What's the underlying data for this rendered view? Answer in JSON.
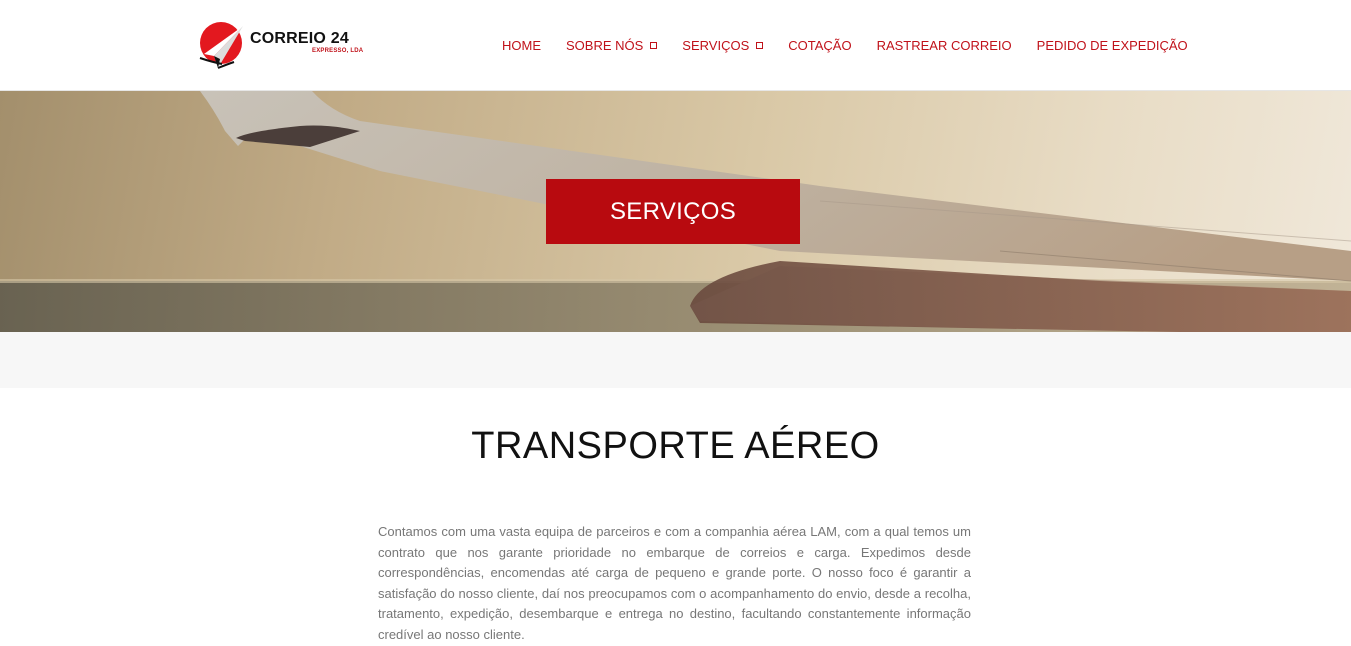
{
  "header": {
    "logo": {
      "name": "CORREIO 24",
      "subtitle": "EXPRESSO, LDA",
      "icon": "paper-plane-logo-icon",
      "brand_color": "#c0121a"
    },
    "nav": {
      "items": [
        {
          "label": "HOME",
          "has_dropdown": false
        },
        {
          "label": "SOBRE NÓS",
          "has_dropdown": true
        },
        {
          "label": "SERVIÇOS",
          "has_dropdown": true
        },
        {
          "label": "COTAÇÃO",
          "has_dropdown": false
        },
        {
          "label": "RASTREAR CORREIO",
          "has_dropdown": false
        },
        {
          "label": "PEDIDO DE EXPEDIÇÃO",
          "has_dropdown": false
        }
      ],
      "color": "#c0121a"
    }
  },
  "hero": {
    "badge_label": "SERVIÇOS",
    "badge_color": "#b80a0f",
    "image": "airplane-wing-sunset"
  },
  "section": {
    "title": "TRANSPORTE AÉREO",
    "body": "Contamos com uma vasta equipa de parceiros e com a companhia aérea LAM, com a qual temos um contrato que nos garante prioridade no embarque de correios e carga. Expedimos desde correspondências, encomendas até carga de pequeno e grande porte. O nosso foco é garantir a satisfação do nosso cliente, daí nos preocupamos com o acompanhamento do envio, desde a recolha, tratamento, expedição, desembarque e entrega no destino, facultando constantemente informação credível ao nosso cliente."
  }
}
